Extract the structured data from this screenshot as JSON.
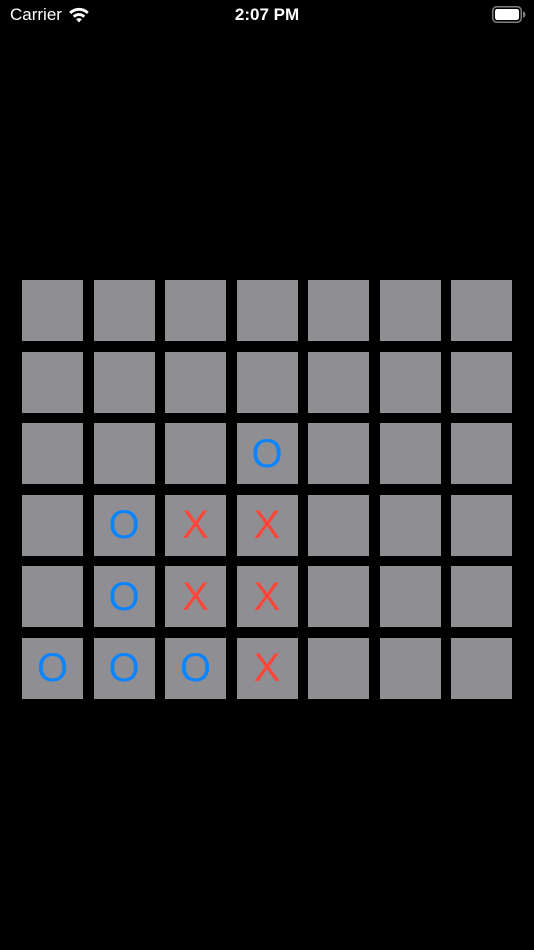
{
  "status_bar": {
    "carrier": "Carrier",
    "time": "2:07 PM",
    "wifi_icon": "wifi-icon",
    "battery_icon": "battery-icon"
  },
  "colors": {
    "background": "#000000",
    "cell": "#8e8e93",
    "o_mark": "#0a84ff",
    "x_mark": "#ff453a"
  },
  "board": {
    "rows": [
      [
        "",
        "",
        "",
        "",
        "",
        "",
        ""
      ],
      [
        "",
        "",
        "",
        "",
        "",
        "",
        ""
      ],
      [
        "",
        "",
        "",
        "O",
        "",
        "",
        ""
      ],
      [
        "",
        "O",
        "X",
        "X",
        "",
        "",
        ""
      ],
      [
        "",
        "O",
        "X",
        "X",
        "",
        "",
        ""
      ],
      [
        "O",
        "O",
        "O",
        "X",
        "",
        "",
        ""
      ]
    ]
  }
}
